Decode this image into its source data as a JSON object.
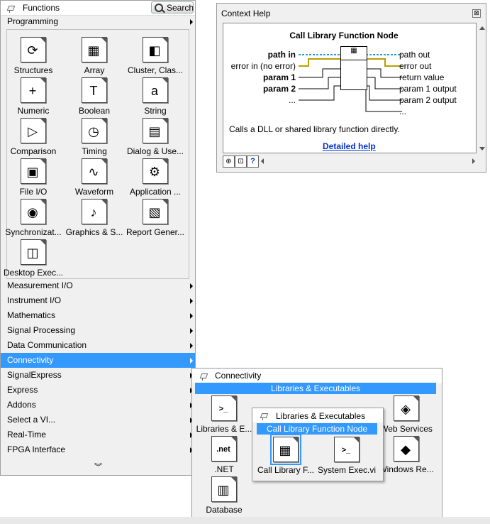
{
  "functions": {
    "title": "Functions",
    "search_label": "Search",
    "section_header": "Programming",
    "icons": [
      {
        "label": "Structures",
        "glyph": "⟳",
        "icon": "structures-icon"
      },
      {
        "label": "Array",
        "glyph": "▦",
        "icon": "array-icon"
      },
      {
        "label": "Cluster, Clas...",
        "glyph": "◧",
        "icon": "cluster-icon"
      },
      {
        "label": "Numeric",
        "glyph": "+",
        "icon": "numeric-icon"
      },
      {
        "label": "Boolean",
        "glyph": "T",
        "icon": "boolean-icon"
      },
      {
        "label": "String",
        "glyph": "a",
        "icon": "string-icon"
      },
      {
        "label": "Comparison",
        "glyph": "▷",
        "icon": "comparison-icon"
      },
      {
        "label": "Timing",
        "glyph": "◷",
        "icon": "timing-icon"
      },
      {
        "label": "Dialog & Use...",
        "glyph": "▤",
        "icon": "dialog-icon"
      },
      {
        "label": "File I/O",
        "glyph": "▣",
        "icon": "file-io-icon"
      },
      {
        "label": "Waveform",
        "glyph": "∿",
        "icon": "waveform-icon"
      },
      {
        "label": "Application ...",
        "glyph": "⚙",
        "icon": "application-control-icon"
      },
      {
        "label": "Synchronizat...",
        "glyph": "◉",
        "icon": "synchronization-icon"
      },
      {
        "label": "Graphics & S...",
        "glyph": "♪",
        "icon": "graphics-sound-icon"
      },
      {
        "label": "Report Gener...",
        "glyph": "▧",
        "icon": "report-generation-icon"
      },
      {
        "label": "Desktop Exec...",
        "glyph": "◫",
        "icon": "desktop-execution-icon"
      }
    ],
    "menu": [
      "Measurement I/O",
      "Instrument I/O",
      "Mathematics",
      "Signal Processing",
      "Data Communication",
      "Connectivity",
      "SignalExpress",
      "Express",
      "Addons",
      "Select a VI...",
      "Real-Time",
      "FPGA Interface"
    ],
    "more_glyph": "︾"
  },
  "context_help": {
    "title": "Context Help",
    "node_title": "Call Library Function Node",
    "inputs": [
      "path in",
      "error in (no error)",
      "param 1",
      "param 2",
      "..."
    ],
    "outputs": [
      "path out",
      "error out",
      "return value",
      "param 1 output",
      "param 2 output",
      "..."
    ],
    "description": "Calls a DLL or shared library function directly.",
    "detailed_link": "Detailed help",
    "close_glyph": "⊠"
  },
  "connectivity": {
    "title": "Connectivity",
    "highlight": "Libraries & Executables",
    "icons": [
      {
        "label": "Libraries & E...",
        "glyph": ">_",
        "icon": "libraries-executables-icon"
      },
      {
        "label": "Web Services",
        "glyph": "◈",
        "icon": "web-services-icon"
      },
      {
        "label": ".NET",
        "glyph": ".net",
        "icon": "dotnet-icon"
      },
      {
        "label": "Windows Re...",
        "glyph": "◆",
        "icon": "windows-registry-icon"
      },
      {
        "label": "Database",
        "glyph": "▥",
        "icon": "database-icon"
      }
    ]
  },
  "libraries": {
    "title": "Libraries & Executables",
    "highlight": "Call Library Function Node",
    "icons": [
      {
        "label": "Call Library F...",
        "glyph": "▦",
        "icon": "call-library-icon"
      },
      {
        "label": "System Exec.vi",
        "glyph": ">_",
        "icon": "system-exec-icon"
      }
    ]
  }
}
